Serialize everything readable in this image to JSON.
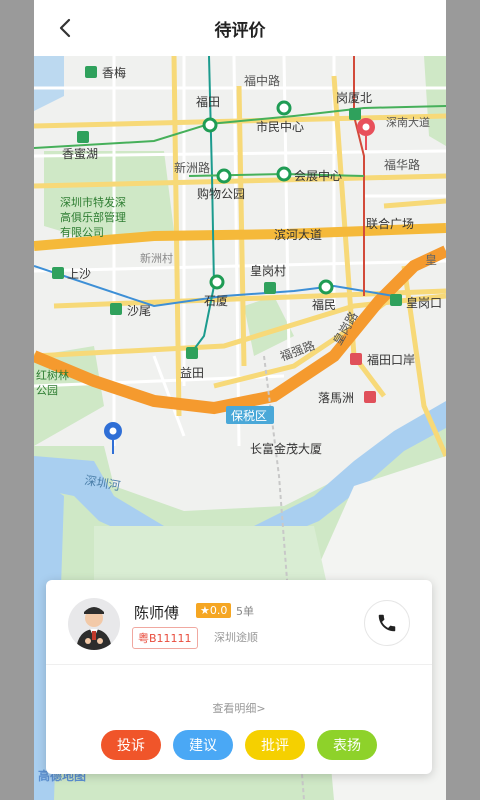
{
  "header": {
    "title": "待评价"
  },
  "map": {
    "labels": {
      "xiangmei": "香梅",
      "futian": "福田",
      "fuzhonglu": "福中路",
      "shiminzhongxin": "市民中心",
      "gangxiabei": "岗厦北",
      "shennandadao": "深南大道",
      "xiangmihu": "香蜜湖",
      "xinzhoulu": "新洲路",
      "gouwugongyuan": "购物公园",
      "huizhanzhongxin": "会展中心",
      "fuhualu": "福华路",
      "tequ1": "深圳市特发深",
      "tequ2": "高俱乐部管理",
      "tequ3": "有限公司",
      "lianheguangchang": "联合广场",
      "binhedadao": "滨河大道",
      "xinzhoucun": "新洲村",
      "huanggangcun": "皇岗村",
      "huang": "皇",
      "shangsha": "上沙",
      "shasha": "沙尾",
      "shixia": "石厦",
      "fumin": "福民",
      "huanggangkou": "皇岗口",
      "huangganglu": "皇岗路",
      "futiankouan": "福田口岸",
      "fuqianglu": "福强路",
      "yitian": "益田",
      "hongshulin1": "红树林",
      "hongshulin2": "公园",
      "luomazhou": "落馬洲",
      "baoshuiqu": "保税区",
      "changfu": "长富金茂大厦",
      "shenzhenhe": "深圳河",
      "logo": "高德地图"
    }
  },
  "driver": {
    "name": "陈师傅",
    "rating": "★0.0",
    "orders": "5单",
    "plate": "粤B11111",
    "company": "深圳途顺"
  },
  "detail_link": "查看明细>",
  "actions": [
    {
      "label": "投诉",
      "color": "#f0552a"
    },
    {
      "label": "建议",
      "color": "#4aa8f5"
    },
    {
      "label": "批评",
      "color": "#f5d000"
    },
    {
      "label": "表扬",
      "color": "#8ed22a"
    }
  ]
}
